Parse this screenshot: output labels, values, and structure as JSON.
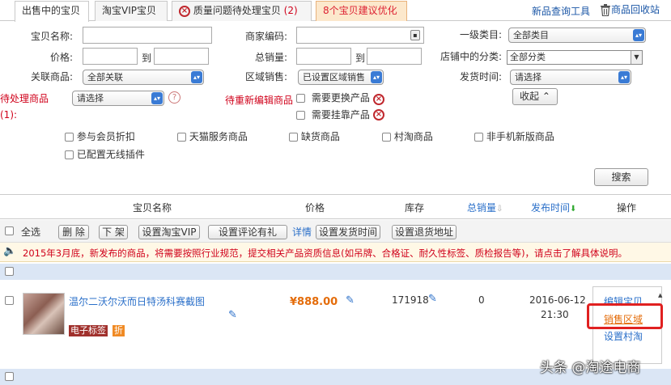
{
  "tabs": {
    "on_sale": "出售中的宝贝",
    "vip": "淘宝VIP宝贝",
    "quality": "质量问题待处理宝贝",
    "quality_count": "(2)",
    "optimize": "8个宝贝建议优化"
  },
  "top_links": {
    "new_product_query": "新品查询工具",
    "recycle_bin": "商品回收站"
  },
  "form": {
    "product_name_label": "宝贝名称:",
    "merchant_code_label": "商家编码:",
    "category_label": "一级类目:",
    "category_value": "全部类目",
    "price_label": "价格:",
    "to": "到",
    "total_sales_label": "总销量:",
    "shop_category_label": "店铺中的分类:",
    "shop_category_value": "全部分类",
    "related_label": "关联商品:",
    "related_value": "全部关联",
    "region_label": "区域销售:",
    "region_value": "已设置区域销售",
    "ship_time_label": "发货时间:",
    "ship_time_value": "请选择",
    "pending_label": "待处理商品(1):",
    "pending_value": "请选择",
    "re_edit_label": "待重新编辑商品",
    "need_replace": "需要更换产品",
    "need_attach": "需要挂靠产品",
    "collapse": "收起",
    "checks": [
      "参与会员折扣",
      "天猫服务商品",
      "缺货商品",
      "村淘商品",
      "非手机新版商品",
      "已配置无线插件"
    ],
    "search_button": "搜索"
  },
  "table": {
    "headers": {
      "name": "宝贝名称",
      "price": "价格",
      "stock": "库存",
      "total_sales": "总销量",
      "publish_time": "发布时间",
      "actions": "操作"
    },
    "toolbar": {
      "select_all": "全选",
      "delete": "删 除",
      "delist": "下 架",
      "set_vip": "设置淘宝VIP",
      "set_review_gift": "设置评论有礼",
      "details": "详情",
      "set_ship_time": "设置发货时间",
      "set_return_address": "设置退货地址"
    },
    "notice": "2015年3月底，新发布的商品，将需要按照行业规范，提交相关产品资质信息(如吊牌、合格证、耐久性标签、质检报告等)，请点击了解具体说明。",
    "rows": [
      {
        "title": "温尔二沃尔沃而日特汤科赛截图",
        "badge_e_label": "电子标签",
        "badge_discount": "折",
        "price": "¥888.00",
        "stock": "171918",
        "sales": "0",
        "date": "2016-06-12",
        "time": "21:30",
        "action_edit": "编辑宝贝",
        "action_sales_region": "销售区域",
        "action_village": "设置村淘"
      }
    ]
  },
  "watermark": "头条 @淘途电商",
  "colors": {
    "accent_blue": "#2a6fc9",
    "warn_red": "#d0021b",
    "price_orange": "#e46c0a",
    "highlight_red": "#e02020"
  }
}
